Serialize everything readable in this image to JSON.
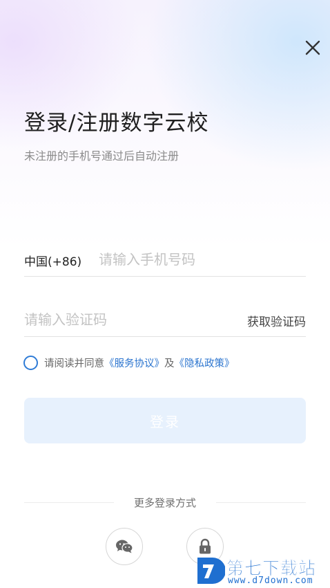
{
  "header": {
    "close_icon": "close-icon",
    "title": "登录/注册数字云校",
    "subtitle": "未注册的手机号通过后自动注册"
  },
  "phone": {
    "country_code": "中国(+86)",
    "placeholder": "请输入手机号码",
    "value": ""
  },
  "verification": {
    "placeholder": "请输入验证码",
    "value": "",
    "get_code_label": "获取验证码"
  },
  "agreement": {
    "checked": false,
    "prefix": "请阅读并同意",
    "service_link": "《服务协议》",
    "conjunction": "及",
    "privacy_link": "《隐私政策》"
  },
  "login_button": {
    "label": "登录",
    "enabled": false
  },
  "more_login": {
    "label": "更多登录方式",
    "options": [
      {
        "icon": "wechat-icon"
      },
      {
        "icon": "lock-icon"
      }
    ]
  },
  "watermark": {
    "title": "第七下载站",
    "url": "www.d7down.com"
  },
  "colors": {
    "accent": "#2c75cf",
    "button_disabled_bg": "#e7f1fd",
    "placeholder": "#c3c3c3"
  }
}
